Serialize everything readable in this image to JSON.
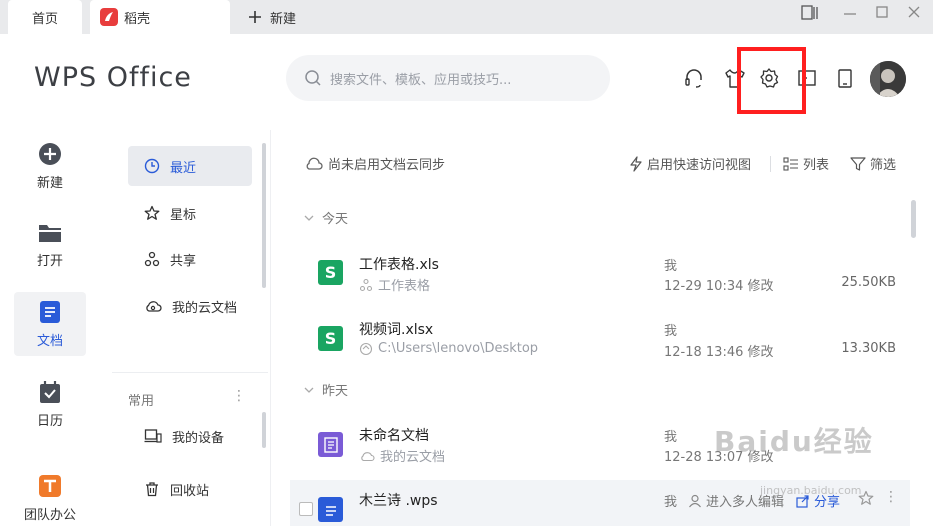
{
  "tabs": {
    "home": "首页",
    "daoke": "稻壳",
    "new_tab": "新建"
  },
  "header": {
    "logo": "WPS Office",
    "search_placeholder": "搜索文件、模板、应用或技巧..."
  },
  "rail": {
    "new": "新建",
    "open": "打开",
    "docs": "文档",
    "calendar": "日历",
    "team": "团队办公"
  },
  "sidebar": {
    "recent": "最近",
    "starred": "星标",
    "shared": "共享",
    "cloud_docs": "我的云文档",
    "common_label": "常用",
    "my_devices": "我的设备",
    "recycle_bin": "回收站"
  },
  "toolbar": {
    "cloud_sync": "尚未启用文档云同步",
    "quick_access": "启用快速访问视图",
    "list": "列表",
    "filter": "筛选"
  },
  "groups": {
    "today": "今天",
    "yesterday": "昨天"
  },
  "files": [
    {
      "name": "工作表格.xls",
      "sub": "工作表格",
      "owner": "我",
      "time": "12-29 10:34 修改",
      "size": "25.50KB"
    },
    {
      "name": "视频词.xlsx",
      "sub": "C:\\Users\\lenovo\\Desktop",
      "owner": "我",
      "time": "12-18 13:46 修改",
      "size": "13.30KB"
    },
    {
      "name": "未命名文档",
      "sub": "我的云文档",
      "owner": "我",
      "time": "12-28 13:07 修改",
      "size": ""
    },
    {
      "name": "木兰诗 .wps",
      "sub": "",
      "owner": "我",
      "action": "进入多人编辑",
      "share": "分享"
    }
  ],
  "watermark": {
    "text": "Baidu经验",
    "sub": "jingyan.baidu.com"
  },
  "colors": {
    "accent": "#2a5bd8",
    "sheet_green": "#1aa562",
    "doc_purple": "#7a5bd6",
    "highlight_red": "#ff1f1f"
  }
}
